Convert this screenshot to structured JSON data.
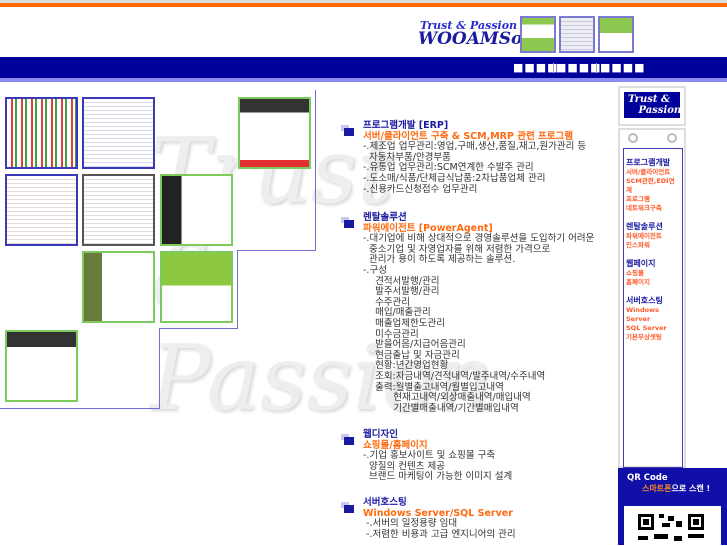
{
  "header": {
    "tagline": "Trust & Passion",
    "brand": "WOOAMSoft"
  },
  "nav": {
    "items": [
      "■■■■",
      "■■■■",
      "■■■■"
    ]
  },
  "watermark": "Trust & Passion",
  "sections": [
    {
      "title": "프로그램개발 [ERP]",
      "subtitle": "서버/클라이언트 구축 & SCM,MRP 관련 프로그램",
      "lines": [
        "-.제조업 업무관리:영업,구매,생산,품질,재고,원가관리 등",
        "  자동차부품/안경부품",
        "-.유통업 업무관리:SCM연계한 수발주 관리",
        "-.도소매/식품/단체급식납품:2차납품업체 관리",
        "-.신용카드신청접수 업무관리"
      ]
    },
    {
      "title": "렌탈솔루션",
      "subtitle": "파워에이전트 [PowerAgent]",
      "lines": [
        "-.대기업에 비해 상대적으로 경영솔루션을 도입하기 어려운",
        "  중소기업 및 자영업자를 위해 저렴한 가격으로",
        "  관리가 용이 하도록 제공하는 솔루션.",
        "-.구성",
        "    견적서발행/관리",
        "    발주서발행/관리",
        "    수주관리",
        "    매입/매출관리",
        "    매출업체한도관리",
        "    미수금관리",
        "    받을어음/지급어음관리",
        "    현금출납 및 자금관리",
        "    현황:년간영업현황",
        "    조회:자금내역/견적내역/발주내역/수주내역",
        "    출력:월별출고내역/월별입고내역",
        "          현재고내역/외상매출내역/매입내역",
        "          기간별매출내역/기간별매입내역"
      ]
    },
    {
      "title": "웹디자인",
      "subtitle": "쇼핑몰/홈페이지",
      "lines": [
        "-.기업 홍보사이트 및 쇼핑몰 구축",
        "  양질의 컨텐츠 제공",
        "  브랜드 마케팅이 가능한 이미지 설계"
      ]
    },
    {
      "title": "서버호스팅",
      "subtitle": "Windows Server/SQL Server",
      "lines": [
        " -.서버의 일정용량 임대",
        " -.저렴한 비용과 고급 엔지니어의 관리"
      ]
    }
  ],
  "sidebar": {
    "logo": [
      "Trust &",
      "Passion"
    ],
    "groups": [
      {
        "title": "프로그램개발",
        "items": [
          "서버/클라이언트",
          "SCM관련,EDI연계",
          "프로그램",
          "네트워크구축"
        ]
      },
      {
        "title": "렌탈솔루션",
        "items": [
          "파워에이전트",
          "인스파워"
        ]
      },
      {
        "title": "웹페이지",
        "items": [
          "쇼핑몰",
          "홈페이지"
        ]
      },
      {
        "title": "서버호스팅",
        "items": [
          "Windows Server",
          "SQL Server",
          "기본무상셋팅"
        ]
      }
    ]
  },
  "qr": {
    "title": "QR Code",
    "scan_highlight": "스마트폰",
    "scan_rest": "으로 스캔 !"
  }
}
